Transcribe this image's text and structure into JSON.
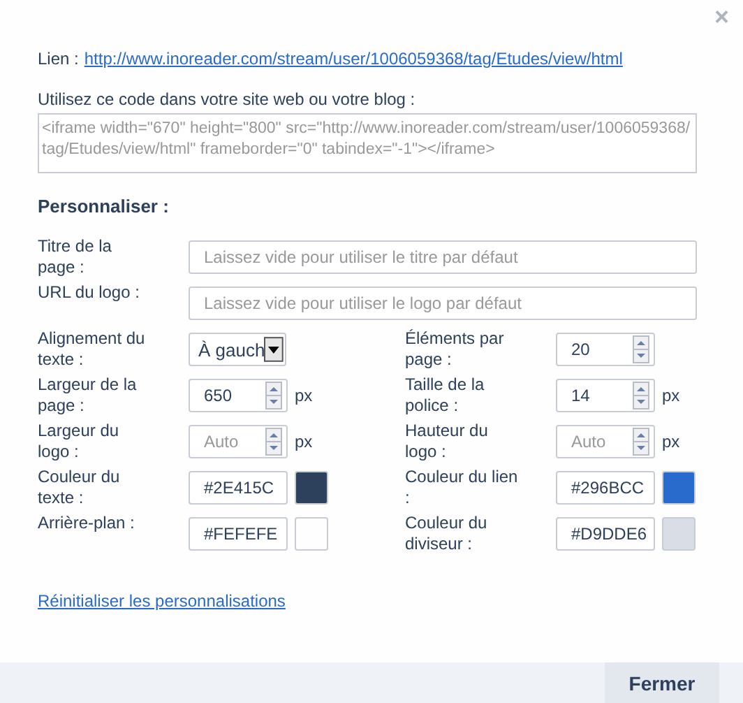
{
  "close_button": "×",
  "link": {
    "label": "Lien :",
    "url": "http://www.inoreader.com/stream/user/1006059368/tag/Etudes/view/html"
  },
  "embed": {
    "label": "Utilisez ce code dans votre site web ou votre blog :",
    "code": "<iframe width=\"670\" height=\"800\" src=\"http://www.inoreader.com/stream/user/1006059368/tag/Etudes/view/html\" frameborder=\"0\" tabindex=\"-1\"></iframe>"
  },
  "section_title": "Personnaliser :",
  "text_fields": [
    {
      "label": "Titre de la page :",
      "placeholder": "Laissez vide pour utiliser le titre par défaut"
    },
    {
      "label": "URL du logo :",
      "placeholder": "Laissez vide pour utiliser le logo par défaut"
    }
  ],
  "options": [
    {
      "kind": "select",
      "label": "Alignement du texte :",
      "value": "À gauch"
    },
    {
      "kind": "number",
      "label": "Éléments par page :",
      "value": "20"
    },
    {
      "kind": "number",
      "label": "Largeur de la page :",
      "value": "650",
      "unit": "px"
    },
    {
      "kind": "number",
      "label": "Taille de la police :",
      "value": "14",
      "unit": "px"
    },
    {
      "kind": "number",
      "label": "Largeur du logo :",
      "placeholder": "Auto",
      "unit": "px"
    },
    {
      "kind": "number",
      "label": "Hauteur du logo :",
      "placeholder": "Auto",
      "unit": "px"
    },
    {
      "kind": "color",
      "label": "Couleur du texte :",
      "value": "#2E415C",
      "color": "#2e415c"
    },
    {
      "kind": "color",
      "label": "Couleur du lien :",
      "value": "#296BCC",
      "color": "#296bcc"
    },
    {
      "kind": "color",
      "label": "Arrière-plan :",
      "value": "#FEFEFE",
      "color": "#fefefe"
    },
    {
      "kind": "color",
      "label": "Couleur du diviseur :",
      "value": "#D9DDE6",
      "color": "#d9dde6"
    }
  ],
  "reset_link": "Réinitialiser les personnalisations",
  "footer": {
    "button": "Fermer"
  }
}
